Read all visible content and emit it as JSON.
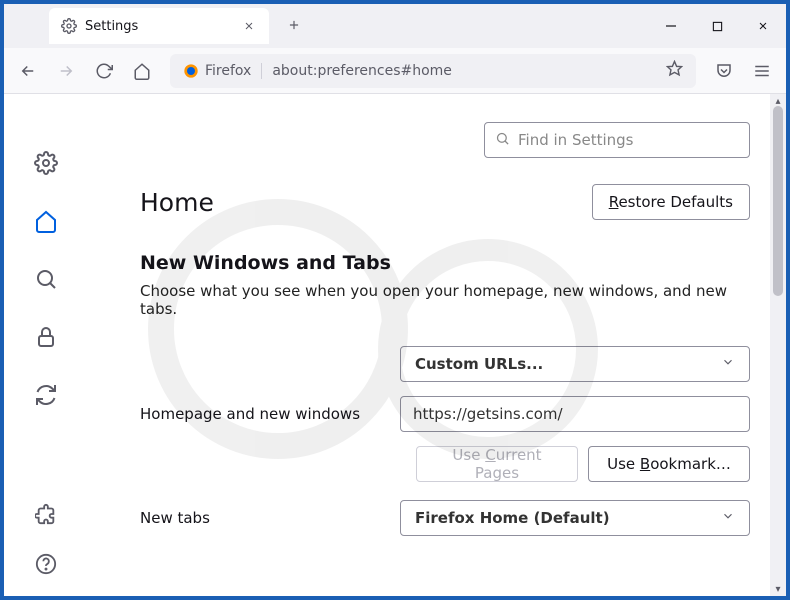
{
  "tab": {
    "label": "Settings"
  },
  "addr": {
    "brand": "Firefox",
    "url": "about:preferences#home"
  },
  "search": {
    "placeholder": "Find in Settings"
  },
  "page": {
    "title": "Home",
    "restore_defaults": "Restore Defaults"
  },
  "section": {
    "title": "New Windows and Tabs",
    "desc": "Choose what you see when you open your homepage, new windows, and new tabs."
  },
  "homepage": {
    "label": "Homepage and new windows",
    "select_value": "Custom URLs...",
    "url_value": "https://getsins.com/",
    "use_current": "Use Current Pages",
    "use_bookmark": "Use Bookmark…"
  },
  "newtabs": {
    "label": "New tabs",
    "select_value": "Firefox Home (Default)"
  }
}
